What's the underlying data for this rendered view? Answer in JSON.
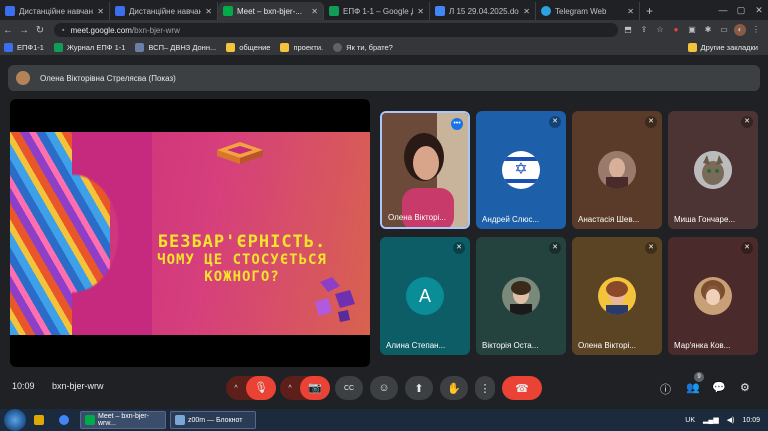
{
  "browser": {
    "tabs": [
      {
        "title": "Дистанційне навчанн",
        "favicon_color": "#3c6ef0",
        "active": false
      },
      {
        "title": "Дистанційне навчанн",
        "favicon_color": "#3c6ef0",
        "active": false
      },
      {
        "title": "Meet – bxn-bjer-...",
        "favicon_color": "#00ac47",
        "active": true
      },
      {
        "title": "ЕПФ 1-1 – Google Д",
        "favicon_color": "#0f9d58",
        "active": false
      },
      {
        "title": "Л 15 29.04.2025.docx",
        "favicon_color": "#4285f4",
        "active": false
      },
      {
        "title": "Telegram Web",
        "favicon_color": "#2aa3e0",
        "active": false
      }
    ],
    "new_tab": "+",
    "close_glyph": "✕",
    "window_controls": [
      "—",
      "▢",
      "✕"
    ],
    "nav": {
      "back": "←",
      "forward": "→",
      "reload": "↻"
    },
    "url_prefix": "meet.google.com",
    "url_path": "/bxn-bjer-wrw",
    "extension_icons": [
      "⬒",
      "⇪",
      "☆",
      "●",
      "▣",
      "✱",
      "▭",
      "◐",
      "⋮"
    ],
    "bookmarks": [
      {
        "label": "ЕПФ1-1",
        "color": "#3c6ef0"
      },
      {
        "label": "Журнал ЕПФ 1-1",
        "color": "#0f9d58"
      },
      {
        "label": "ВСП– ДВНЗ Донн...",
        "color": "#6b7fa6"
      },
      {
        "label": "общение",
        "color": "#f2c33b"
      },
      {
        "label": "проекти.",
        "color": "#f2c33b"
      },
      {
        "label": "Як ти, брате?",
        "color": "#5f6368"
      }
    ],
    "bookmarks_other": "Другие закладки"
  },
  "meet": {
    "presenter_label": "Олена Вікторівна Стрелясва (Показ)",
    "slide": {
      "line1": "БЕЗБАР'ЄРНІСТЬ.",
      "line2": "ЧОМУ ЦЕ СТОСУЄТЬСЯ",
      "line3": "КОЖНОГО?"
    },
    "participants": [
      {
        "name": "Олена Вікторі...",
        "bg": "#3f2a2a",
        "type": "video"
      },
      {
        "name": "Андрей Слюс...",
        "bg": "#1d5fa8",
        "type": "flag"
      },
      {
        "name": "Анастасія Шев...",
        "bg": "#5a3b2a",
        "type": "photo"
      },
      {
        "name": "Миша Гончаре...",
        "bg": "#4d3434",
        "type": "photo"
      },
      {
        "name": "Алина Степан...",
        "bg": "#0c5d66",
        "type": "letter",
        "letter": "A"
      },
      {
        "name": "Вікторія Оста...",
        "bg": "#25433e",
        "type": "photo"
      },
      {
        "name": "Олена Вікторі...",
        "bg": "#5b4424",
        "type": "photo"
      },
      {
        "name": "Мар'янка Ков...",
        "bg": "#4a2a2a",
        "type": "photo"
      }
    ],
    "mute_glyph": "🎤",
    "time": "10:09",
    "code": "bxn-bjer-wrw",
    "participant_count": "9",
    "controls": {
      "chevron": "^",
      "mic": "🎙",
      "camera": "📷",
      "captions": "CC",
      "emoji": "☺",
      "present": "⬆",
      "hand": "✋",
      "more": "⋮",
      "hangup": "☎",
      "info": "ⓘ",
      "people": "👥",
      "chat": "💬",
      "activities": "⚙"
    }
  },
  "taskbar": {
    "apps": [
      {
        "label": "",
        "color": "#e0a800"
      },
      {
        "label": "",
        "color": "#4285f4"
      },
      {
        "label": "Meet – bxn-bjer-wrw...",
        "color": "#00ac47"
      },
      {
        "label": "z00m — Блокнот",
        "color": "#7aa7d6"
      }
    ],
    "lang": "UK",
    "clock": "10:09"
  }
}
